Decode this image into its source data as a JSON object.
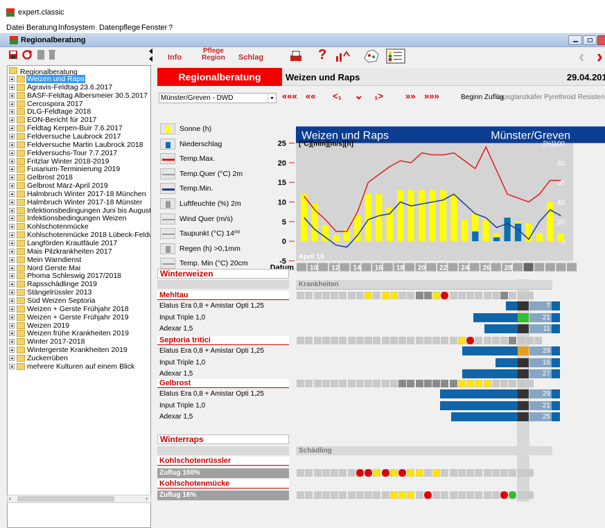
{
  "app": {
    "title": "expert.classic"
  },
  "menu": [
    "Datei",
    "Beratung",
    "Infosystem",
    "Datenpflege",
    "Fenster",
    "?"
  ],
  "child_window": {
    "title": "Regionalberatung"
  },
  "tree": {
    "root": "Regionalberatung",
    "items": [
      "Weizen und Raps",
      "Agravis-Feldtag 23.6.2017",
      "BASF-Feldtag Albersmeier 30.5.2017",
      "Cercospora 2017",
      "DLG-Feldtage 2018",
      "EON-Bericht für 2017",
      "Feldtag Kerpen-Buir 7.6.2017",
      "Feldversuche Laubrock 2017",
      "Feldversuche Martin Laubrock 2018",
      "Feldversuchs-Tour 7.7.2017",
      "Fritzlar Winter 2018-2019",
      "Fusarium-Terminierung 2019",
      "Gelbrost 2018",
      "Gelbrost März-April 2019",
      "Halmbruch Winter 2017-18 München",
      "Halmbruch Winter 2017-18 Münster",
      "Infektionsbedingungen Juni bis August",
      "Infektionsbedingungen Weizen",
      "Kohlschotenmücke",
      "Kohlschotenmücke 2018 Lübeck-Feldweg",
      "Langförden Krautfäule 2017",
      "Mais Pilzkrankheiten 2017",
      "Mein Warndienst",
      "Nord Gerste Mai",
      "Phoma Schleswig 2017/2018",
      "Rapsschädlinge 2019",
      "Stängelrüssler 2013",
      "Süd Weizen Septoria",
      "Weizen + Gerste Frühjahr 2018",
      "Weizen + Gerste Frühjahr 2019",
      "Weizen 2019",
      "Weizen frühe Krankheiten 2019",
      "Winter 2017-2018",
      "Wintergerste Krankheiten 2019",
      "Zuckerrüben",
      "mehrere Kulturen auf einem Blick"
    ],
    "selected_index": 0
  },
  "toolbar": {
    "info": "Info",
    "pflege_region": "Pflege\nRegion",
    "schlag": "Schlag"
  },
  "header": {
    "region_label": "Regionalberatung",
    "crop": "Weizen und Raps",
    "date": "29.04.2019"
  },
  "station": {
    "selected": "Münster/Greven - DWD"
  },
  "nav": {
    "first": "«««",
    "prev_week": "««",
    "prev_day": "<₁",
    "today": "⌄",
    "next_day": "₁>",
    "next_week": "»»",
    "last": "»»»"
  },
  "buttons": {
    "beginn_zuflug": "Beginn Zuflug",
    "raps": "Rapsglanzkäfer Pyrethroid Resistenz"
  },
  "legend": [
    {
      "label": "Sonne (h)",
      "color": "#ffff00"
    },
    {
      "label": "Niederschlag",
      "color": "#0a6fb5"
    },
    {
      "label": "Temp.Max.",
      "color": "#e31b1b"
    },
    {
      "label": "Temp.Quer (°C) 2m",
      "color": "#9a9a9a"
    },
    {
      "label": "Temp.Min.",
      "color": "#1b3a9a"
    },
    {
      "label": "Luftfeuchte (%) 2m",
      "color": "#9a9a9a"
    },
    {
      "label": "Wind Quer (m/s)",
      "color": "#9a9a9a"
    },
    {
      "label": "Taupunkt (°C) 14⁰⁰",
      "color": "#9a9a9a"
    },
    {
      "label": "Regen (h) >0,1mm",
      "color": "#9a9a9a"
    },
    {
      "label": "Temp. Min (°C) 20cm",
      "color": "#9a9a9a"
    }
  ],
  "chart_data": {
    "type": "line",
    "title": "Weizen und Raps",
    "subtitle": "Münster/Greven",
    "ylabel": "[°C][mm][m/s][h]",
    "y2label": "[%]",
    "ylim": [
      -5,
      25
    ],
    "yticks": [
      25,
      20,
      15,
      10,
      5,
      0,
      -5
    ],
    "y2ticks": [
      "100",
      "80",
      "60",
      "40",
      "20",
      "0"
    ],
    "month_label": "April 19",
    "xlabel": "Datum",
    "x": [
      1,
      2,
      3,
      4,
      5,
      6,
      7,
      8,
      9,
      10,
      11,
      12,
      13,
      14,
      15,
      16,
      17,
      18,
      19,
      20,
      21,
      22,
      23,
      24,
      25,
      26,
      27,
      28,
      29,
      30
    ],
    "x_ticks": [
      "10",
      "12",
      "14",
      "16",
      "18",
      "20",
      "22",
      "24",
      "26",
      "28",
      "30"
    ],
    "series": [
      {
        "name": "Temp.Max.",
        "color": "#e31b1b",
        "values": [
          11.5,
          8,
          5.5,
          2.5,
          2.5,
          7.5,
          15,
          17,
          19,
          20.5,
          20,
          22.5,
          22,
          22,
          22.5,
          20.5,
          18.5,
          24,
          18,
          12,
          11,
          10,
          12,
          15.5,
          15.5
        ]
      },
      {
        "name": "Temp.Min.",
        "color": "#1b3a9a",
        "values": [
          6,
          3,
          1,
          -1,
          -1.5,
          1.5,
          5.5,
          6.5,
          7,
          10,
          9,
          9.5,
          10,
          10.5,
          12,
          9.5,
          7,
          6,
          3.5,
          4.5,
          3,
          0.5,
          5,
          8,
          6.5
        ]
      },
      {
        "name": "Sonne (h)",
        "color": "#ffff00",
        "values": [
          12,
          9.5,
          4,
          1.5,
          3,
          6.5,
          12,
          12,
          8.5,
          13,
          13,
          13,
          13,
          13,
          12,
          5.5,
          7,
          5.5,
          2,
          6,
          5,
          4.5,
          2,
          10,
          2
        ]
      },
      {
        "name": "Niederschlag",
        "color": "#0a6fb5",
        "values": [
          0,
          0,
          0,
          0,
          0,
          0,
          0,
          0,
          0,
          0,
          0,
          0,
          0,
          0,
          0,
          0,
          2.5,
          0,
          1,
          6,
          4.5,
          0,
          0,
          0,
          0
        ]
      }
    ]
  },
  "sections": {
    "winterweizen": "Winterweizen",
    "krankheiten": "Krankheiten",
    "mehltau": "Mehltau",
    "septoria": "Septoria tritici",
    "gelbrost": "Gelbrost",
    "winterraps": "Winterraps",
    "schaedling": "Schädling",
    "kohlschotenruessler": "Kohlschotenrüssler",
    "kohlschotenmuecke": "Kohlschotenmücke",
    "zuflug1": "Zuflug 100%",
    "zuflug2": "Zuflug 16%"
  },
  "products": {
    "mehltau": [
      {
        "name": "Elatus Era 0,8 + Amistar Opti 1,25",
        "value": "7"
      },
      {
        "name": "Input Triple 1,0",
        "value": "21"
      },
      {
        "name": "Adexar 1,5",
        "value": "11"
      }
    ],
    "septoria": [
      {
        "name": "Elatus Era 0,8 + Amistar Opti 1,25",
        "value": "29"
      },
      {
        "name": "Input Triple 1,0",
        "value": "16"
      },
      {
        "name": "Adexar 1,5",
        "value": "27"
      }
    ],
    "gelbrost": [
      {
        "name": "Elatus Era 0,8 + Amistar Opti 1,25",
        "value": "29"
      },
      {
        "name": "Input Triple 1,0",
        "value": "21"
      },
      {
        "name": "Adexar 1,5",
        "value": "25"
      }
    ]
  },
  "risk_rows": {
    "mehltau": [
      "g",
      "g",
      "g",
      "g",
      "g",
      "g",
      "g",
      "g",
      "y",
      "g",
      "y",
      "y",
      "g",
      "g",
      "d",
      "d",
      "y",
      "r",
      "g",
      "g",
      "g",
      "g",
      "g",
      "g",
      "d",
      "g",
      "g",
      "g"
    ],
    "septoria": [
      "g",
      "g",
      "g",
      "g",
      "g",
      "g",
      "g",
      "g",
      "g",
      "g",
      "g",
      "g",
      "g",
      "g",
      "g",
      "g",
      "g",
      "g",
      "g",
      "y",
      "r",
      "g",
      "g",
      "g",
      "g",
      "d",
      "g",
      "g",
      "g"
    ],
    "gelbrost": [
      "g",
      "g",
      "g",
      "g",
      "g",
      "g",
      "g",
      "g",
      "g",
      "g",
      "g",
      "g",
      "d",
      "d",
      "d",
      "d",
      "d",
      "d",
      "d",
      "y",
      "y",
      "y",
      "y",
      "g",
      "g",
      "g",
      "g",
      "g"
    ],
    "ruessler": [
      "g",
      "g",
      "g",
      "g",
      "g",
      "g",
      "g",
      "r",
      "r",
      "y",
      "r",
      "y",
      "r",
      "y",
      "y",
      "g",
      "y",
      "g",
      "g",
      "g",
      "g",
      "g",
      "g",
      "g",
      "g",
      "g",
      "g",
      "g"
    ],
    "muecke": [
      "g",
      "g",
      "g",
      "g",
      "g",
      "g",
      "g",
      "g",
      "g",
      "g",
      "g",
      "y",
      "y",
      "y",
      "g",
      "r",
      "g",
      "g",
      "g",
      "g",
      "g",
      "g",
      "g",
      "g",
      "r",
      "G",
      "g",
      "g"
    ]
  }
}
